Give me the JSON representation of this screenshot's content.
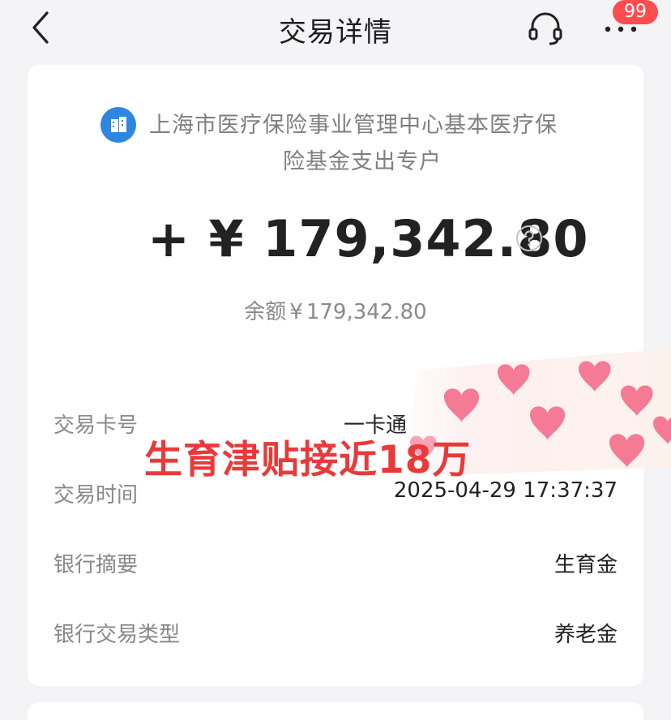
{
  "nav": {
    "title": "交易详情",
    "badge_count": "99",
    "back_icon": "chevron-left-icon",
    "support_icon": "headset-icon",
    "more_icon": "more-dots-icon"
  },
  "transaction": {
    "payer_icon": "building-icon",
    "payer_line1": "上海市医疗保险事业管理中心基本医疗保",
    "payer_line2": "险基金支出专户",
    "sign": "+",
    "currency": "¥",
    "amount": "179,342.80",
    "balance_label": "余额",
    "balance_currency": "¥",
    "balance_value": "179,342.80",
    "help_icon": "question-circle-icon"
  },
  "details": [
    {
      "label": "交易卡号",
      "value": "一卡通"
    },
    {
      "label": "交易时间",
      "value": "2025-04-29 17:37:37"
    },
    {
      "label": "银行摘要",
      "value": "生育金"
    },
    {
      "label": "银行交易类型",
      "value": "养老金"
    }
  ],
  "overlay": {
    "caption": "生育津贴接近18万",
    "sticker": "hearts-sticker"
  },
  "colors": {
    "background": "#f4f4f6",
    "card": "#ffffff",
    "badge": "#ff4d4f",
    "icon_blue": "#2f86e0",
    "caption_red": "#e83a3a",
    "heart_pink": "#f57a96"
  }
}
